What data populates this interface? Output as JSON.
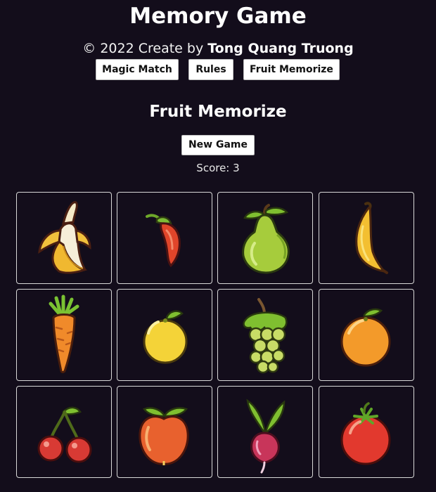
{
  "header": {
    "title": "Memory Game",
    "credit_prefix": "© 2022 Create by ",
    "author": "Tong Quang Truong"
  },
  "nav": {
    "items": [
      "Magic Match",
      "Rules",
      "Fruit Memorize"
    ]
  },
  "game": {
    "title": "Fruit Memorize",
    "new_game_label": "New Game",
    "score_label": "Score:",
    "score": 3
  },
  "cards": [
    {
      "fruit": "peeled-banana-icon"
    },
    {
      "fruit": "chili-pepper-icon"
    },
    {
      "fruit": "pear-icon"
    },
    {
      "fruit": "banana-icon"
    },
    {
      "fruit": "carrot-icon"
    },
    {
      "fruit": "lemon-icon"
    },
    {
      "fruit": "grapes-icon"
    },
    {
      "fruit": "orange-icon"
    },
    {
      "fruit": "cherries-icon"
    },
    {
      "fruit": "apple-icon"
    },
    {
      "fruit": "radish-icon"
    },
    {
      "fruit": "tomato-icon"
    }
  ],
  "colors": {
    "background": "#130d1b",
    "text": "#ffffff",
    "button_bg": "#ffffff",
    "card_border": "#d8d8d8"
  }
}
